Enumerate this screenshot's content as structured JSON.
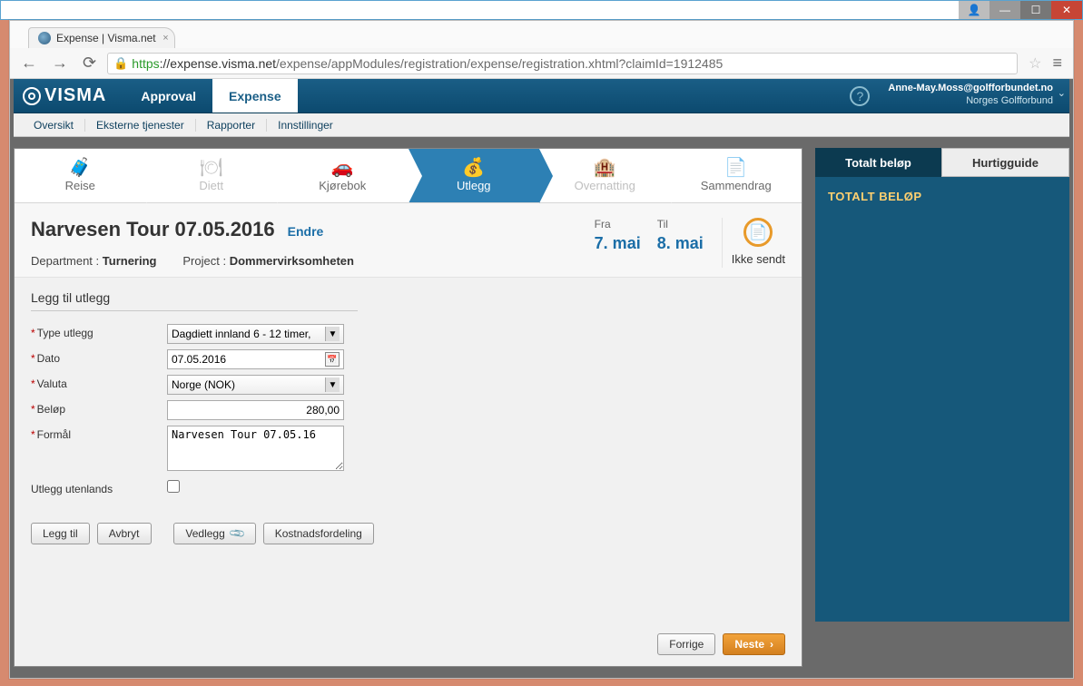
{
  "window": {
    "tab_title": "Expense | Visma.net",
    "url_https": "https",
    "url_host": "://expense.visma.net",
    "url_path": "/expense/appModules/registration/expense/registration.xhtml?claimId=1912485"
  },
  "header": {
    "logo": "VISMA",
    "tabs": {
      "approval": "Approval",
      "expense": "Expense"
    },
    "user_email": "Anne-May.Moss@golfforbundet.no",
    "user_org": "Norges Golfforbund"
  },
  "subnav": {
    "oversikt": "Oversikt",
    "eksterne": "Eksterne tjenester",
    "rapporter": "Rapporter",
    "innstillinger": "Innstillinger"
  },
  "steps": {
    "reise": "Reise",
    "diett": "Diett",
    "kjorebok": "Kjørebok",
    "utlegg": "Utlegg",
    "overnatting": "Overnatting",
    "sammendrag": "Sammendrag"
  },
  "claim": {
    "title": "Narvesen Tour 07.05.2016",
    "edit": "Endre",
    "dept_label": "Department :",
    "dept_value": "Turnering",
    "project_label": "Project :",
    "project_value": "Dommervirksomheten",
    "from_label": "Fra",
    "from_value": "7. mai",
    "to_label": "Til",
    "to_value": "8. mai",
    "status": "Ikke sendt"
  },
  "form": {
    "section_title": "Legg til utlegg",
    "labels": {
      "type": "Type utlegg",
      "date": "Dato",
      "currency": "Valuta",
      "amount": "Beløp",
      "purpose": "Formål",
      "abroad": "Utlegg utenlands"
    },
    "values": {
      "type": "Dagdiett innland 6 - 12 timer,",
      "date": "07.05.2016",
      "currency": "Norge (NOK)",
      "amount": "280,00",
      "purpose": "Narvesen Tour 07.05.16"
    },
    "buttons": {
      "add": "Legg til",
      "cancel": "Avbryt",
      "attach": "Vedlegg",
      "costalloc": "Kostnadsfordeling"
    }
  },
  "footer": {
    "prev": "Forrige",
    "next": "Neste"
  },
  "side": {
    "tab_total": "Totalt beløp",
    "tab_guide": "Hurtigguide",
    "title": "TOTALT BELØP"
  }
}
